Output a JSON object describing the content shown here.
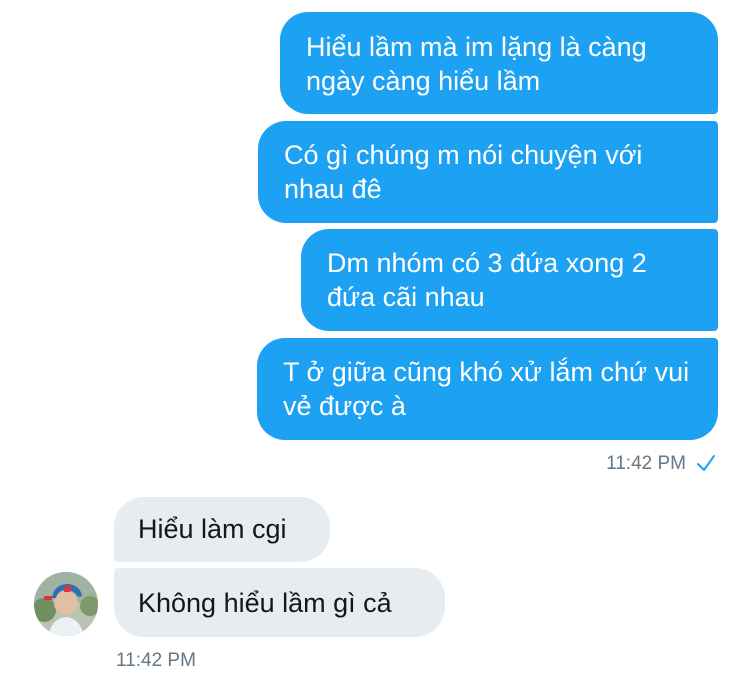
{
  "conversation": {
    "outgoing": [
      {
        "text": "Hiểu lầm mà im lặng là càng ngày càng hiểu lầm"
      },
      {
        "text": "Có gì chúng m nói chuyện với nhau đê"
      },
      {
        "text": "Dm nhóm có 3 đứa xong 2 đứa cãi nhau"
      },
      {
        "text": "T ở giữa cũng khó xử lắm chứ vui vẻ được à"
      }
    ],
    "outgoing_time": "11:42 PM",
    "outgoing_status_icon": "check-icon",
    "incoming": [
      {
        "text": "Hiểu làm cgi"
      },
      {
        "text": "Không hiểu lầm gì cả"
      }
    ],
    "incoming_time": "11:42 PM"
  },
  "colors": {
    "outgoing_bubble": "#1DA1F2",
    "incoming_bubble": "#E6ECF0",
    "meta_text": "#657786"
  }
}
